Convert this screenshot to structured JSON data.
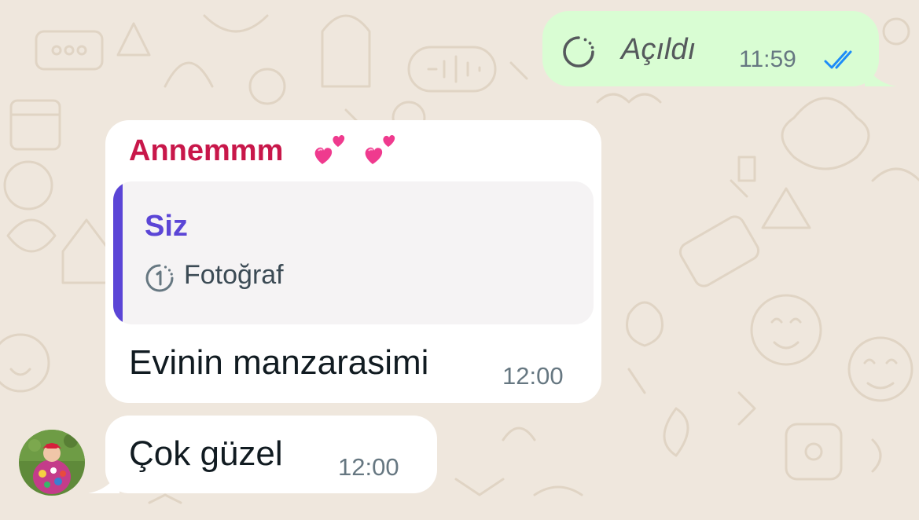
{
  "chat": {
    "background_color": "#efe7dd",
    "messages": [
      {
        "direction": "outgoing",
        "icon": "view-once-icon",
        "text": "Açıldı",
        "time": "11:59",
        "status_icon": "double-check-read-icon",
        "status_color": "#1d8cf8",
        "bubble_color": "#d9fdd3"
      },
      {
        "direction": "incoming",
        "sender": "Annemmm",
        "sender_emojis": [
          "💕",
          "💕"
        ],
        "sender_color": "#c8174a",
        "quote": {
          "author": "Siz",
          "author_color": "#5b45d6",
          "icon": "view-once-photo-icon",
          "text": "Fotoğraf"
        },
        "text": "Evinin manzarasimi",
        "time": "12:00"
      },
      {
        "direction": "incoming",
        "avatar": "contact-avatar",
        "text": "Çok güzel",
        "time": "12:00"
      }
    ]
  }
}
